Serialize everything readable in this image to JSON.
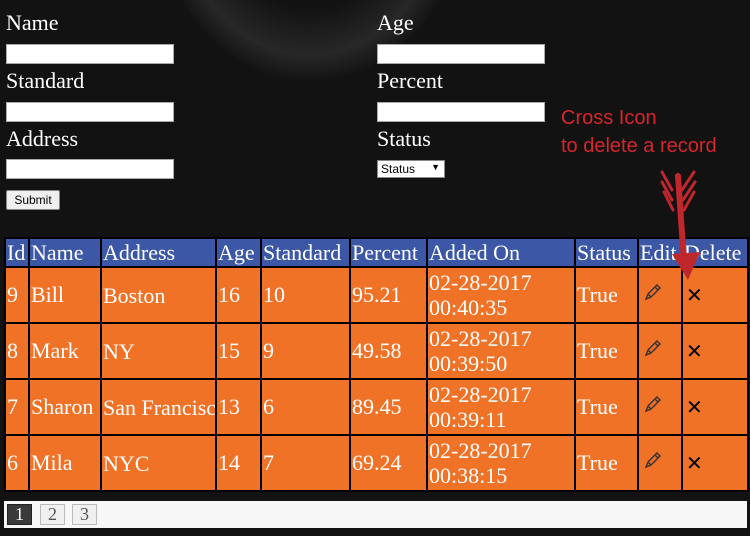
{
  "form": {
    "name_label": "Name",
    "age_label": "Age",
    "standard_label": "Standard",
    "percent_label": "Percent",
    "address_label": "Address",
    "status_label": "Status",
    "name_value": "",
    "age_value": "",
    "standard_value": "",
    "percent_value": "",
    "address_value": "",
    "status_select_value": "Status",
    "submit_label": "Submit"
  },
  "annotation": {
    "line1": "Cross Icon",
    "line2": "to delete a record",
    "color": "#d7262b"
  },
  "table": {
    "headers": [
      "Id",
      "Name",
      "Address",
      "Age",
      "Standard",
      "Percent",
      "Added On",
      "Status",
      "Edit",
      "Delete"
    ],
    "rows": [
      {
        "id": "9",
        "name": "Bill",
        "address": "Boston",
        "age": "16",
        "standard": "10",
        "percent": "95.21",
        "added_on_date": "02-28-2017",
        "added_on_time": "00:40:35",
        "status": "True"
      },
      {
        "id": "8",
        "name": "Mark",
        "address": "NY",
        "age": "15",
        "standard": "9",
        "percent": "49.58",
        "added_on_date": "02-28-2017",
        "added_on_time": "00:39:50",
        "status": "True"
      },
      {
        "id": "7",
        "name": "Sharon",
        "address": "San Francisco",
        "age": "13",
        "standard": "6",
        "percent": "89.45",
        "added_on_date": "02-28-2017",
        "added_on_time": "00:39:11",
        "status": "True"
      },
      {
        "id": "6",
        "name": "Mila",
        "address": "NYC",
        "age": "14",
        "standard": "7",
        "percent": "69.24",
        "added_on_date": "02-28-2017",
        "added_on_time": "00:38:15",
        "status": "True"
      }
    ],
    "edit_icon": "pencil-icon",
    "delete_icon": "cross-icon",
    "header_color": "#3b57a5",
    "row_color": "#f07227"
  },
  "pagination": {
    "pages": [
      "1",
      "2",
      "3"
    ],
    "current": "1"
  }
}
